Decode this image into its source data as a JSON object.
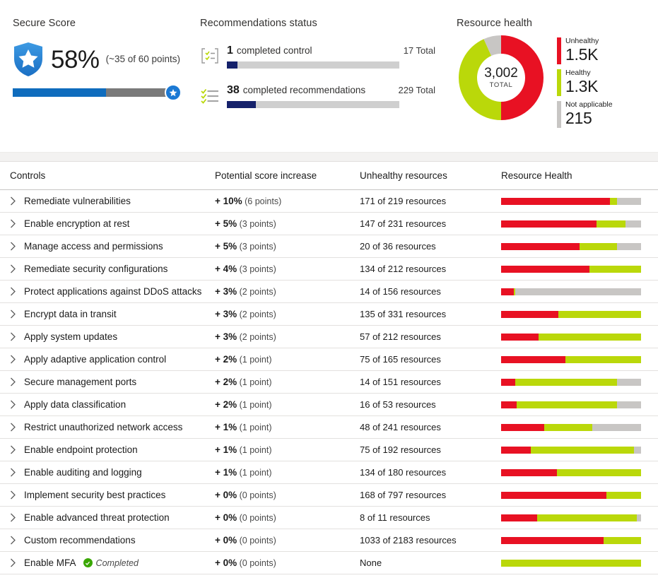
{
  "secure_score": {
    "title": "Secure Score",
    "percent_label": "58%",
    "percent_value": 58,
    "points_label": "(~35 of 60 points)",
    "shield_icon": "shield-star-icon",
    "accent_color": "#0f6cbd"
  },
  "recommendations_status": {
    "title": "Recommendations status",
    "items": [
      {
        "icon": "controls-list-icon",
        "count": "1",
        "label": "completed control",
        "total": "17 Total",
        "progress_percent": 6
      },
      {
        "icon": "checklist-icon",
        "count": "38",
        "label": "completed recommendations",
        "total": "229 Total",
        "progress_percent": 17
      }
    ],
    "bar_fill_color": "#15216b",
    "bar_track_color": "#cfcfcf"
  },
  "resource_health": {
    "title": "Resource health",
    "total_value": "3,002",
    "total_label": "TOTAL",
    "legend": [
      {
        "name": "Unhealthy",
        "value": "1.5K",
        "color": "#e81123",
        "share": 50.0
      },
      {
        "name": "Healthy",
        "value": "1.3K",
        "color": "#bad80a",
        "share": 43.3
      },
      {
        "name": "Not applicable",
        "value": "215",
        "color": "#c8c6c4",
        "share": 6.7
      }
    ]
  },
  "table": {
    "columns": {
      "controls": "Controls",
      "potential_score_increase": "Potential score increase",
      "unhealthy_resources": "Unhealthy resources",
      "resource_health": "Resource Health"
    },
    "expand_icon": "chevron-right-icon",
    "rows": [
      {
        "name": "Remediate vulnerabilities",
        "percent": "+ 10%",
        "points": "(6 points)",
        "unhealthy": "171 of 219 resources",
        "bar": {
          "unhealthy": 78,
          "healthy": 5,
          "na": 17
        }
      },
      {
        "name": "Enable encryption at rest",
        "percent": "+ 5%",
        "points": "(3 points)",
        "unhealthy": "147 of 231 resources",
        "bar": {
          "unhealthy": 68,
          "healthy": 21,
          "na": 11
        }
      },
      {
        "name": "Manage access and permissions",
        "percent": "+ 5%",
        "points": "(3 points)",
        "unhealthy": "20 of 36 resources",
        "bar": {
          "unhealthy": 56,
          "healthy": 27,
          "na": 17
        }
      },
      {
        "name": "Remediate security configurations",
        "percent": "+ 4%",
        "points": "(3 points)",
        "unhealthy": "134 of 212 resources",
        "bar": {
          "unhealthy": 63,
          "healthy": 37,
          "na": 0
        }
      },
      {
        "name": "Protect applications against DDoS attacks",
        "percent": "+ 3%",
        "points": "(2 points)",
        "unhealthy": "14 of 156 resources",
        "bar": {
          "unhealthy": 9,
          "healthy": 1,
          "na": 90
        }
      },
      {
        "name": "Encrypt data in transit",
        "percent": "+ 3%",
        "points": "(2 points)",
        "unhealthy": "135 of 331 resources",
        "bar": {
          "unhealthy": 41,
          "healthy": 59,
          "na": 0
        }
      },
      {
        "name": "Apply system updates",
        "percent": "+ 3%",
        "points": "(2 points)",
        "unhealthy": "57 of 212 resources",
        "bar": {
          "unhealthy": 27,
          "healthy": 73,
          "na": 0
        }
      },
      {
        "name": "Apply adaptive application control",
        "percent": "+ 2%",
        "points": "(1 point)",
        "unhealthy": "75 of 165 resources",
        "bar": {
          "unhealthy": 46,
          "healthy": 54,
          "na": 0
        }
      },
      {
        "name": "Secure management ports",
        "percent": "+ 2%",
        "points": "(1 point)",
        "unhealthy": "14 of 151 resources",
        "bar": {
          "unhealthy": 10,
          "healthy": 73,
          "na": 17
        }
      },
      {
        "name": "Apply data classification",
        "percent": "+ 2%",
        "points": "(1 point)",
        "unhealthy": "16 of 53 resources",
        "bar": {
          "unhealthy": 11,
          "healthy": 72,
          "na": 17
        }
      },
      {
        "name": "Restrict unauthorized network access",
        "percent": "+ 1%",
        "points": "(1 point)",
        "unhealthy": "48 of 241 resources",
        "bar": {
          "unhealthy": 31,
          "healthy": 34,
          "na": 35
        }
      },
      {
        "name": "Enable endpoint protection",
        "percent": "+ 1%",
        "points": "(1 point)",
        "unhealthy": "75 of 192 resources",
        "bar": {
          "unhealthy": 21,
          "healthy": 74,
          "na": 5
        }
      },
      {
        "name": "Enable auditing and logging",
        "percent": "+ 1%",
        "points": "(1 point)",
        "unhealthy": "134 of 180 resources",
        "bar": {
          "unhealthy": 40,
          "healthy": 60,
          "na": 0
        }
      },
      {
        "name": "Implement security best practices",
        "percent": "+ 0%",
        "points": "(0 points)",
        "unhealthy": "168 of 797 resources",
        "bar": {
          "unhealthy": 75,
          "healthy": 25,
          "na": 0
        }
      },
      {
        "name": "Enable advanced threat protection",
        "percent": "+ 0%",
        "points": "(0 points)",
        "unhealthy": "8 of 11 resources",
        "bar": {
          "unhealthy": 26,
          "healthy": 71,
          "na": 3
        }
      },
      {
        "name": "Custom recommendations",
        "percent": "+ 0%",
        "points": "(0 points)",
        "unhealthy": "1033 of 2183 resources",
        "bar": {
          "unhealthy": 73,
          "healthy": 27,
          "na": 0
        }
      },
      {
        "name": "Enable MFA",
        "status_badge": "Completed",
        "percent": "+ 0%",
        "points": "(0 points)",
        "unhealthy": "None",
        "bar": {
          "unhealthy": 0,
          "healthy": 100,
          "na": 0
        }
      }
    ]
  }
}
